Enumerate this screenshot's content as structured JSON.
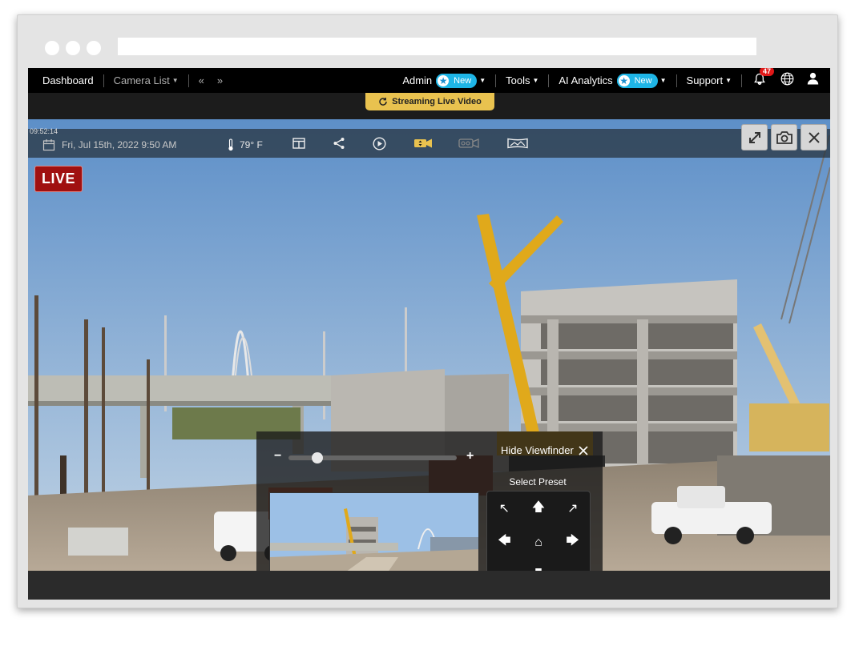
{
  "nav": {
    "dashboard": "Dashboard",
    "camera_list": "Camera List",
    "prev": "«",
    "next": "»",
    "admin": "Admin",
    "new_badge": "New",
    "tools": "Tools",
    "ai_analytics": "AI Analytics",
    "support": "Support",
    "notifications_count": "47"
  },
  "streaming_label": "Streaming Live Video",
  "toolbar": {
    "clock": "09:52:14",
    "date": "Fri, Jul 15th, 2022 9:50 AM",
    "temperature": "79° F"
  },
  "live_label": "LIVE",
  "viewfinder": {
    "zoom_minus": "−",
    "zoom_plus": "+",
    "zoom_level": 0.15,
    "hide_label": "Hide Viewfinder",
    "preset_label": "Select Preset"
  },
  "ptz": [
    {
      "name": "pan-up-left-button",
      "glyph": "↖"
    },
    {
      "name": "pan-up-button",
      "glyph": "🡅"
    },
    {
      "name": "pan-up-right-button",
      "glyph": "↗"
    },
    {
      "name": "pan-left-button",
      "glyph": "🡄"
    },
    {
      "name": "home-button",
      "glyph": "⌂"
    },
    {
      "name": "pan-right-button",
      "glyph": "🡆"
    },
    {
      "name": "pan-down-left-button",
      "glyph": "↙"
    },
    {
      "name": "pan-down-button",
      "glyph": "🡇"
    },
    {
      "name": "pan-down-right-button",
      "glyph": "↘"
    }
  ],
  "colors": {
    "accent_yellow": "#e9c24f",
    "badge_blue": "#1eb5e6",
    "live_red": "#a01010",
    "alert_red": "#e01818"
  }
}
